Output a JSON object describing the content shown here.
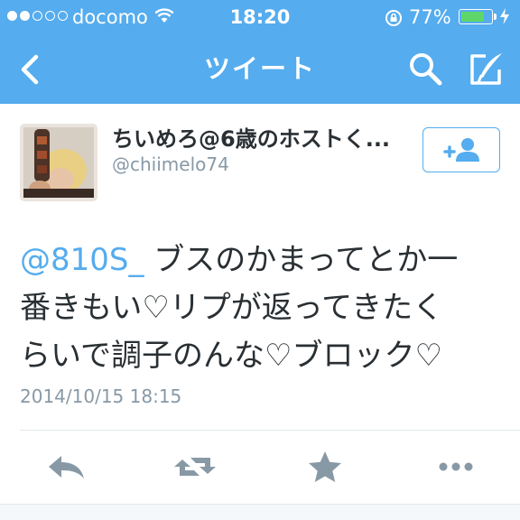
{
  "colors": {
    "brand": "#55acee",
    "text": "#292f33",
    "secondary": "#8899a6",
    "action_icon": "#8899a6",
    "battery_fill": "#5fd66a"
  },
  "status_bar": {
    "carrier": "docomo",
    "signal_bars_filled": 2,
    "signal_bars_total": 5,
    "time": "18:20",
    "battery_percent_label": "77%",
    "battery_level": 0.77,
    "icons": [
      "signal-dots-icon",
      "wifi-icon",
      "rotation-lock-icon",
      "battery-icon",
      "charging-bolt-icon"
    ]
  },
  "nav": {
    "title": "ツイート",
    "icons": [
      "back-chevron-icon",
      "search-icon",
      "compose-tweet-icon"
    ]
  },
  "tweet": {
    "author_name": "ちいめろ@6歳のホストく...",
    "author_handle": "@chiimelo74",
    "follow_icon": "follow-user-icon",
    "mention": "@810S_",
    "text_line1_rest": " ブスのかまってとか一",
    "text_line2": "番きもい♡リプが返ってきたく",
    "text_line3": "らいで調子のんな♡ブロック♡",
    "timestamp": "2014/10/15 18:15"
  },
  "actions": [
    "reply-icon",
    "retweet-icon",
    "favorite-star-icon",
    "more-dots-icon"
  ]
}
